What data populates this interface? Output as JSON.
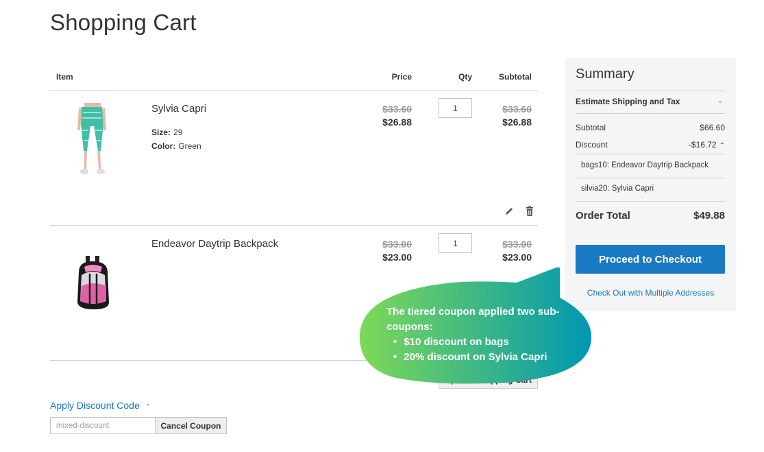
{
  "page": {
    "title": "Shopping Cart"
  },
  "cart": {
    "headers": {
      "item": "Item",
      "price": "Price",
      "qty": "Qty",
      "subtotal": "Subtotal"
    },
    "items": [
      {
        "name": "Sylvia Capri",
        "image": "capri-pants-image",
        "options": [
          {
            "label": "Size:",
            "value": "29"
          },
          {
            "label": "Color:",
            "value": "Green"
          }
        ],
        "price_original": "$33.60",
        "price_discounted": "$26.88",
        "qty": "1",
        "subtotal_original": "$33.60",
        "subtotal_discounted": "$26.88",
        "actions": [
          "edit-icon",
          "trash-icon"
        ]
      },
      {
        "name": "Endeavor Daytrip Backpack",
        "image": "backpack-image",
        "options": [],
        "price_original": "$33.00",
        "price_discounted": "$23.00",
        "qty": "1",
        "subtotal_original": "$33.00",
        "subtotal_discounted": "$23.00"
      }
    ],
    "update_button": "Update Shopping Cart"
  },
  "discount": {
    "toggle_label": "Apply Discount Code",
    "code_value": "mixed-discount",
    "cancel_label": "Cancel Coupon"
  },
  "summary": {
    "title": "Summary",
    "shipping_label": "Estimate Shipping and Tax",
    "subtotal_label": "Subtotal",
    "subtotal_value": "$66.60",
    "discount_label": "Discount",
    "discount_value": "-$16.72",
    "discount_items": [
      "bags10: Endeavor Daytrip Backpack",
      "silvia20: Sylvia Capri"
    ],
    "total_label": "Order Total",
    "total_value": "$49.88",
    "checkout_label": "Proceed to Checkout",
    "multi_address_label": "Check Out with Multiple Addresses",
    "accent": "#1979c3"
  },
  "callout": {
    "heading": "The tiered coupon applied two sub-coupons:",
    "bullets": [
      "$10 discount on bags",
      "20% discount on Sylvia Capri"
    ],
    "gradient": [
      "#7ed957",
      "#0097b2"
    ]
  }
}
